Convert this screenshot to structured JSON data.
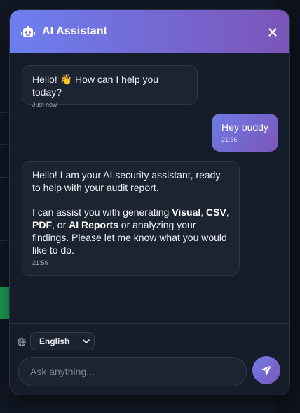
{
  "header": {
    "title": "AI Assistant",
    "bot_icon": "robot-icon",
    "close_icon": "close-icon"
  },
  "messages": [
    {
      "sender": "assistant",
      "text": "Hello! 👋 How can I help you today?",
      "time": "Just now"
    },
    {
      "sender": "user",
      "text": "Hey buddy",
      "time": "21:56"
    },
    {
      "sender": "assistant",
      "line1": "Hello! I am your AI security assistant, ready to help with your audit report.",
      "p2_pre": "I can assist you with generating ",
      "visual": "Visual",
      "sep1": ", ",
      "csv": "CSV",
      "sep2": ",",
      "pdf": "PDF",
      "sep3": ", or ",
      "ai_reports": "AI Reports",
      "p2_post": " or analyzing your findings. Please let me know what you would like to do.",
      "time": "21:56"
    }
  ],
  "footer": {
    "language": "English",
    "input_placeholder": "Ask anything...",
    "globe_icon": "globe-icon",
    "send_icon": "send-icon"
  },
  "colors": {
    "accent_start": "#6d7ff0",
    "accent_end": "#7b55b8",
    "background": "#161d2a",
    "bubble": "#1c2331"
  }
}
